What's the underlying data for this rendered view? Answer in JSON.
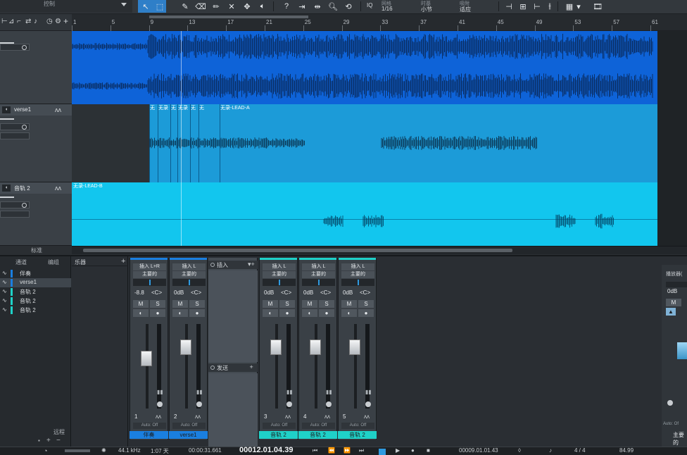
{
  "toolbar": {
    "left_label": "控制",
    "quantize_label": "IQ",
    "grid_heading": "网格",
    "grid_value": "1/16",
    "timebase_heading": "时基",
    "timebase_value": "小节",
    "snap_heading": "吸附",
    "snap_value": "适应"
  },
  "ruler": {
    "bars": [
      "1",
      "5",
      "9",
      "13",
      "17",
      "21",
      "25",
      "29",
      "33",
      "37",
      "41",
      "45",
      "49",
      "53",
      "57",
      "61"
    ],
    "cursor_bar": "9"
  },
  "tracks": [
    {
      "name": "伴奏",
      "color": "#0e63d8",
      "clips": [
        {
          "label": ""
        }
      ]
    },
    {
      "name": "verse1",
      "color": "#1c9bd8",
      "clips": [
        {
          "label": "无"
        },
        {
          "label": "无录"
        },
        {
          "label": "无"
        },
        {
          "label": "无录"
        },
        {
          "label": "无"
        },
        {
          "label": "无"
        },
        {
          "label": "无录-LEAD-A"
        }
      ]
    },
    {
      "name": "音轨 2",
      "color": "#12c6ee",
      "clips": [
        {
          "label": "无录-LEAD-B"
        }
      ]
    }
  ],
  "arrange_footer": {
    "zoom_label": "标准"
  },
  "channel_list": {
    "header_channels": "通道",
    "header_groups": "编组",
    "items": [
      {
        "name": "伴奏",
        "color": "#1a7fe0",
        "selected": false
      },
      {
        "name": "verse1",
        "color": "#1a7fe0",
        "selected": true
      },
      {
        "name": "音轨 2",
        "color": "#1fd1c8",
        "selected": false
      },
      {
        "name": "音轨 2",
        "color": "#1fd1c8",
        "selected": false
      },
      {
        "name": "音轨 2",
        "color": "#1fd1c8",
        "selected": false
      }
    ],
    "footer_label": "远程"
  },
  "instrument_panel": {
    "title": "乐器"
  },
  "fx_column": {
    "inserts_label": "插入",
    "sends_label": "发送"
  },
  "mixer": {
    "strips": [
      {
        "input": "插入 L+R",
        "output": "主要的",
        "volume": "-8.8",
        "pan": "<C>",
        "number": "1",
        "auto": "Auto: Off",
        "name": "伴奏",
        "color": "#1a7fe0",
        "fader_level": 0.62
      },
      {
        "input": "插入 L",
        "output": "主要的",
        "volume": "0dB",
        "pan": "<C>",
        "number": "2",
        "auto": "Auto: Off",
        "name": "verse1",
        "color": "#1a7fe0",
        "fader_level": 0.78
      },
      {
        "input": "插入 L",
        "output": "主要的",
        "volume": "0dB",
        "pan": "<C>",
        "number": "3",
        "auto": "Auto: Off",
        "name": "音轨 2",
        "color": "#1fd1c8",
        "fader_level": 0.78
      },
      {
        "input": "插入 L",
        "output": "主要的",
        "volume": "0dB",
        "pan": "<C>",
        "number": "4",
        "auto": "Auto: Off",
        "name": "音轨 2",
        "color": "#1fd1c8",
        "fader_level": 0.78
      },
      {
        "input": "插入 L",
        "output": "主要的",
        "volume": "0dB",
        "pan": "<C>",
        "number": "5",
        "auto": "Auto: Off",
        "name": "音轨 2",
        "color": "#1fd1c8",
        "fader_level": 0.78
      }
    ],
    "main": {
      "header": "播放器(",
      "volume": "0dB",
      "auto": "Auto: Of",
      "name": "主要的"
    }
  },
  "transport": {
    "sample_rate": "44.1 kHz",
    "record_time": "1:07 天",
    "time": "00:00:31.661",
    "position": "00012.01.04.39",
    "loop_end": "00009.01.01.43",
    "signature": "4 / 4",
    "tempo": "84.99"
  }
}
